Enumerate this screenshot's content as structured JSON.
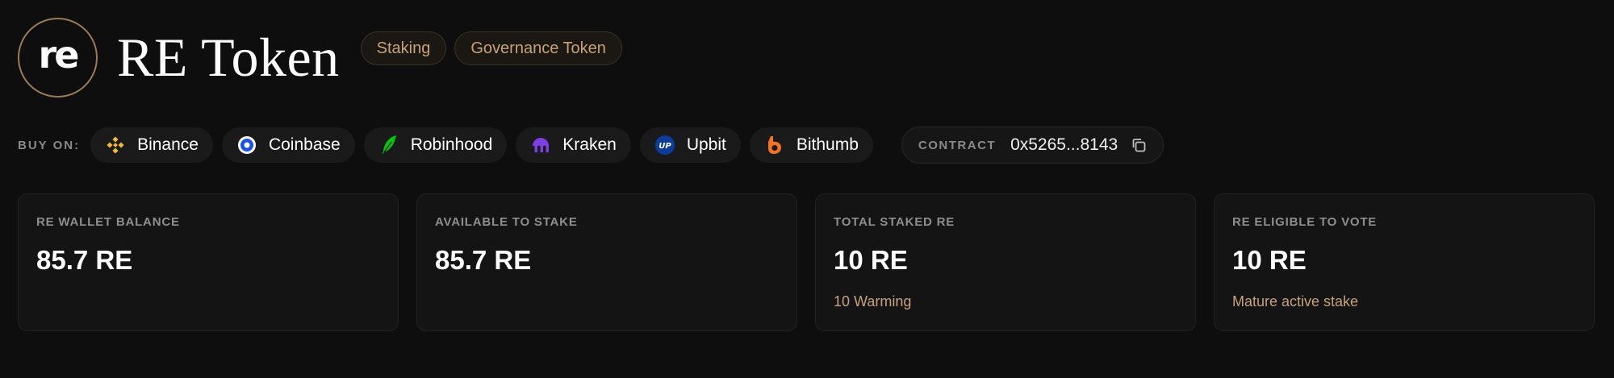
{
  "header": {
    "logo_text": "re",
    "title": "RE Token",
    "tags": [
      "Staking",
      "Governance Token"
    ]
  },
  "buy": {
    "label": "BUY ON:",
    "exchanges": [
      {
        "name": "Binance",
        "icon": "binance-icon",
        "color": "#f3ba2f"
      },
      {
        "name": "Coinbase",
        "icon": "coinbase-icon",
        "color": "#1652f0"
      },
      {
        "name": "Robinhood",
        "icon": "robinhood-feather-icon",
        "color": "#00c805"
      },
      {
        "name": "Kraken",
        "icon": "kraken-icon",
        "color": "#7b3fe4"
      },
      {
        "name": "Upbit",
        "icon": "upbit-icon",
        "color": "#0a3d9c"
      },
      {
        "name": "Bithumb",
        "icon": "bithumb-icon",
        "color": "#f37321"
      }
    ]
  },
  "contract": {
    "label": "CONTRACT",
    "address": "0x5265...8143",
    "copy_icon": "copy-icon"
  },
  "cards": [
    {
      "label": "RE WALLET BALANCE",
      "value": "85.7 RE",
      "sub": ""
    },
    {
      "label": "AVAILABLE TO STAKE",
      "value": "85.7 RE",
      "sub": ""
    },
    {
      "label": "TOTAL STAKED RE",
      "value": "10 RE",
      "sub": "10 Warming"
    },
    {
      "label": "RE ELIGIBLE TO VOTE",
      "value": "10 RE",
      "sub": "Mature active stake"
    }
  ],
  "colors": {
    "background": "#0e0e0e",
    "accent_gold": "#c7a27a",
    "card_bg": "#141414"
  }
}
